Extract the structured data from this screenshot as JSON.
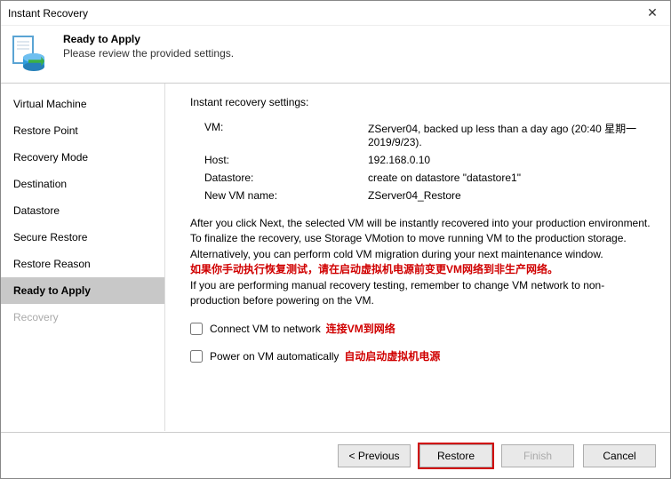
{
  "window": {
    "title": "Instant Recovery"
  },
  "header": {
    "title": "Ready to Apply",
    "subtitle": "Please review the provided  settings."
  },
  "sidebar": {
    "items": [
      {
        "label": "Virtual Machine"
      },
      {
        "label": "Restore Point"
      },
      {
        "label": "Recovery Mode"
      },
      {
        "label": "Destination"
      },
      {
        "label": "Datastore"
      },
      {
        "label": "Secure Restore"
      },
      {
        "label": "Restore Reason"
      },
      {
        "label": "Ready to Apply"
      },
      {
        "label": "Recovery"
      }
    ],
    "active_index": 7,
    "disabled_index": 8
  },
  "content": {
    "section_title": "Instant recovery settings:",
    "settings": {
      "vm_label": "VM:",
      "vm_value": "ZServer04, backed up less than a day ago (20:40 星期一 2019/9/23).",
      "host_label": "Host:",
      "host_value": "192.168.0.10",
      "datastore_label": "Datastore:",
      "datastore_value": "create on datastore \"datastore1\"",
      "newvm_label": "New VM name:",
      "newvm_value": "ZServer04_Restore"
    },
    "paragraph": {
      "l1": "After you click Next, the selected VM will be instantly recovered into your production environment. To finalize the recovery, use Storage VMotion to move running VM to the production storage.",
      "l2": "Alternatively, you can perform cold VM migration during your next maintenance window.",
      "l3_red": "如果你手动执行恢复测试，请在启动虚拟机电源前变更VM网络到非生产网络。",
      "l4": "If you are performing manual recovery testing, remember to change VM network to non-production before powering on the VM."
    },
    "checkboxes": {
      "connect_label": "Connect VM to network",
      "connect_red": "连接VM到网络",
      "connect_checked": false,
      "power_label": "Power on VM automatically",
      "power_red": "自动启动虚拟机电源",
      "power_checked": false
    }
  },
  "footer": {
    "previous": "< Previous",
    "restore": "Restore",
    "finish": "Finish",
    "cancel": "Cancel"
  }
}
